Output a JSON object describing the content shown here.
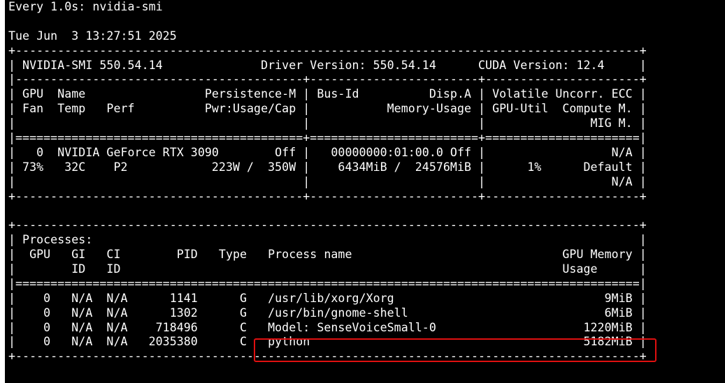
{
  "header": {
    "watch_line": "Every 1.0s: nvidia-smi",
    "timestamp_line": "Tue Jun  3 13:27:51 2025"
  },
  "gpu_table": {
    "lines": [
      "+-----------------------------------------------------------------------------------------+",
      "| NVIDIA-SMI 550.54.14              Driver Version: 550.54.14      CUDA Version: 12.4     |",
      "|-----------------------------------------+------------------------+----------------------+",
      "| GPU  Name                 Persistence-M | Bus-Id          Disp.A | Volatile Uncorr. ECC |",
      "| Fan  Temp   Perf          Pwr:Usage/Cap |           Memory-Usage | GPU-Util  Compute M. |",
      "|                                         |                        |               MIG M. |",
      "|=========================================+========================+======================|",
      "|   0  NVIDIA GeForce RTX 3090        Off |   00000000:01:00.0 Off |                  N/A |",
      "| 73%   32C    P2            223W /  350W |    6434MiB /  24576MiB |      1%      Default |",
      "|                                         |                        |                  N/A |",
      "+-----------------------------------------+------------------------+----------------------+"
    ]
  },
  "process_table": {
    "lines": [
      "+-----------------------------------------------------------------------------------------+",
      "| Processes:                                                                              |",
      "|  GPU   GI   CI        PID   Type   Process name                              GPU Memory |",
      "|        ID   ID                                                               Usage      |",
      "|=========================================================================================|",
      "|    0   N/A  N/A      1141      G   /usr/lib/xorg/Xorg                              9MiB |",
      "|    0   N/A  N/A      1302      G   /usr/bin/gnome-shell                            6MiB |",
      "|    0   N/A  N/A    718496      C   Model: SenseVoiceSmall-0                     1220MiB |",
      "|    0   N/A  N/A   2035380      C   python                                       5182MiB |",
      "+-----------------------------------------------------------------------------------------+"
    ]
  },
  "colors": {
    "background": "#000000",
    "text": "#ffffff",
    "highlight": "#e01010"
  }
}
